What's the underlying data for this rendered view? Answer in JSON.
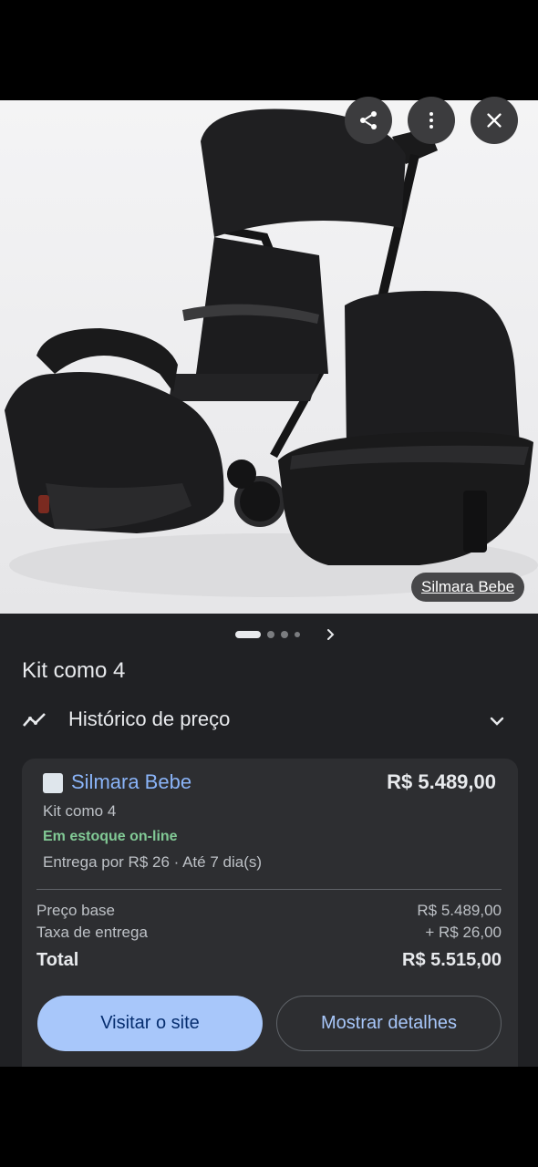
{
  "image": {
    "source_label": "Silmara Bebe",
    "carousel_total": 4,
    "carousel_active": 1
  },
  "icons": {
    "share": "share-icon",
    "more": "more-vert-icon",
    "close": "close-icon",
    "history": "trending-icon",
    "expand": "chevron-down-icon"
  },
  "product": {
    "title": "Kit como 4",
    "price_history_label": "Histórico de preço"
  },
  "offer": {
    "merchant": "Silmara Bebe",
    "price": "R$ 5.489,00",
    "product_name": "Kit como 4",
    "stock": "Em estoque on-line",
    "delivery": "Entrega por R$ 26 · Até 7 dia(s)",
    "base_label": "Preço base",
    "base_value": "R$ 5.489,00",
    "fee_label": "Taxa de entrega",
    "fee_value": "+ R$ 26,00",
    "total_label": "Total",
    "total_value": "R$ 5.515,00",
    "visit_button": "Visitar o site",
    "details_button": "Mostrar detalhes"
  },
  "colors": {
    "background": "#202124",
    "card": "#2d2e31",
    "link": "#8ab4f8",
    "stock": "#81c995",
    "primary_button": "#a8c7fa"
  }
}
